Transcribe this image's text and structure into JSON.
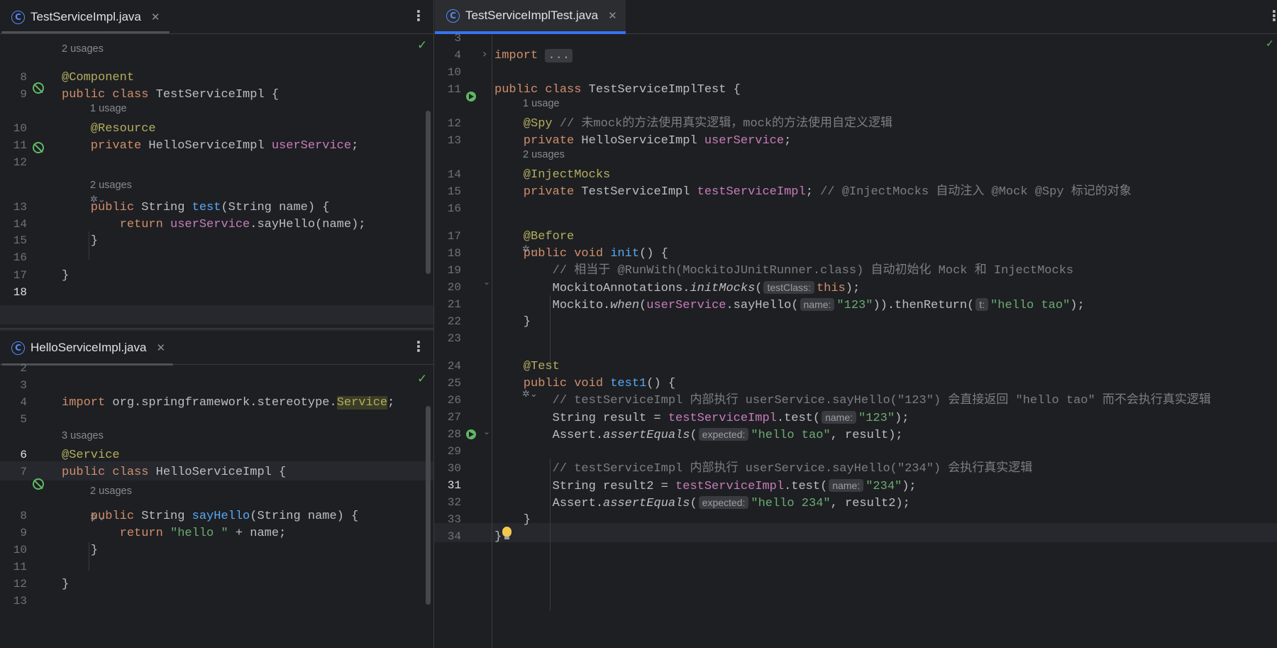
{
  "left_top": {
    "tab": {
      "label": "TestServiceImpl.java"
    },
    "lines": [
      {
        "n": "8",
        "segs": [
          {
            "c": "ann",
            "t": "@Component"
          }
        ]
      },
      {
        "n": "9",
        "segs": [
          {
            "c": "kw",
            "t": "public class "
          },
          {
            "c": "cls",
            "t": "TestServiceImpl {"
          }
        ]
      },
      {
        "n": "10",
        "segs": [
          {
            "c": "ann",
            "t": "    @Resource"
          }
        ]
      },
      {
        "n": "11",
        "segs": [
          {
            "c": "kw",
            "t": "    private "
          },
          {
            "c": "cls",
            "t": "HelloServiceImpl "
          },
          {
            "c": "fld",
            "t": "userService"
          },
          {
            "c": "cls",
            "t": ";"
          }
        ]
      },
      {
        "n": "12",
        "segs": []
      },
      {
        "n": "13",
        "segs": [
          {
            "c": "kw",
            "t": "    public "
          },
          {
            "c": "cls",
            "t": "String "
          },
          {
            "c": "fn",
            "t": "test"
          },
          {
            "c": "cls",
            "t": "(String name) {"
          }
        ]
      },
      {
        "n": "14",
        "segs": [
          {
            "c": "kw",
            "t": "        return "
          },
          {
            "c": "fld",
            "t": "userService"
          },
          {
            "c": "cls",
            "t": ".sayHello(name);"
          }
        ]
      },
      {
        "n": "15",
        "segs": [
          {
            "c": "cls",
            "t": "    }"
          }
        ]
      },
      {
        "n": "16",
        "segs": []
      },
      {
        "n": "17",
        "segs": [
          {
            "c": "cls",
            "t": "}"
          }
        ]
      },
      {
        "n": "18",
        "segs": []
      }
    ],
    "usages": [
      "2 usages",
      "1 usage",
      "2 usages"
    ]
  },
  "left_bottom": {
    "tab": {
      "label": "HelloServiceImpl.java"
    },
    "lines": [
      {
        "n": "2",
        "segs": []
      },
      {
        "n": "3",
        "segs": []
      },
      {
        "n": "4",
        "segs": [
          {
            "c": "kw",
            "t": "import "
          },
          {
            "c": "cls",
            "t": "org.springframework.stereotype."
          },
          {
            "c": "ann svc-box",
            "t": "Service"
          },
          {
            "c": "cls",
            "t": ";"
          }
        ]
      },
      {
        "n": "5",
        "segs": []
      },
      {
        "n": "6",
        "segs": [
          {
            "c": "ann",
            "t": "@Service"
          }
        ]
      },
      {
        "n": "7",
        "segs": [
          {
            "c": "kw",
            "t": "public class "
          },
          {
            "c": "cls",
            "t": "HelloServiceImpl {"
          }
        ]
      },
      {
        "n": "8",
        "segs": [
          {
            "c": "kw",
            "t": "    public "
          },
          {
            "c": "cls",
            "t": "String "
          },
          {
            "c": "fn",
            "t": "sayHello"
          },
          {
            "c": "cls",
            "t": "(String name) {"
          }
        ]
      },
      {
        "n": "9",
        "segs": [
          {
            "c": "kw",
            "t": "        return "
          },
          {
            "c": "str",
            "t": "\"hello \""
          },
          {
            "c": "cls",
            "t": " + name;"
          }
        ]
      },
      {
        "n": "10",
        "segs": [
          {
            "c": "cls",
            "t": "    }"
          }
        ]
      },
      {
        "n": "11",
        "segs": []
      },
      {
        "n": "12",
        "segs": [
          {
            "c": "cls",
            "t": "}"
          }
        ]
      },
      {
        "n": "13",
        "segs": []
      }
    ],
    "usages": [
      "3 usages",
      "2 usages"
    ]
  },
  "right": {
    "tab": {
      "label": "TestServiceImplTest.java"
    },
    "lines": [
      {
        "n": "3",
        "segs": []
      },
      {
        "n": "4",
        "segs": [
          {
            "c": "kw",
            "t": "import "
          },
          {
            "c": "fold-box",
            "t": "..."
          }
        ]
      },
      {
        "n": "10",
        "segs": []
      },
      {
        "n": "11",
        "segs": [
          {
            "c": "kw",
            "t": "public class "
          },
          {
            "c": "cls",
            "t": "TestServiceImplTest {"
          }
        ]
      },
      {
        "n": "12",
        "segs": [
          {
            "c": "ann",
            "t": "    @Spy"
          },
          {
            "c": "cm",
            "t": " // 未mock的方法使用真实逻辑，mock的方法使用自定义逻辑"
          }
        ]
      },
      {
        "n": "13",
        "segs": [
          {
            "c": "kw",
            "t": "    private "
          },
          {
            "c": "cls",
            "t": "HelloServiceImpl "
          },
          {
            "c": "fld",
            "t": "userService"
          },
          {
            "c": "cls",
            "t": ";"
          }
        ]
      },
      {
        "n": "14",
        "segs": [
          {
            "c": "ann",
            "t": "    @InjectMocks"
          }
        ]
      },
      {
        "n": "15",
        "segs": [
          {
            "c": "kw",
            "t": "    private "
          },
          {
            "c": "cls",
            "t": "TestServiceImpl "
          },
          {
            "c": "fld",
            "t": "testServiceImpl"
          },
          {
            "c": "cls",
            "t": "; "
          },
          {
            "c": "cm",
            "t": "// @InjectMocks 自动注入 @Mock @Spy 标记的对象"
          }
        ]
      },
      {
        "n": "16",
        "segs": []
      },
      {
        "n": "17",
        "segs": [
          {
            "c": "ann",
            "t": "    @Before"
          }
        ]
      },
      {
        "n": "18",
        "segs": [
          {
            "c": "kw",
            "t": "    public void "
          },
          {
            "c": "fn",
            "t": "init"
          },
          {
            "c": "cls",
            "t": "() {"
          }
        ]
      },
      {
        "n": "19",
        "segs": [
          {
            "c": "cm",
            "t": "        // 相当于 @RunWith(MockitoJUnitRunner.class) 自动初始化 Mock 和 InjectMocks"
          }
        ]
      },
      {
        "n": "20",
        "segs": [
          {
            "c": "cls",
            "t": "        MockitoAnnotations."
          },
          {
            "c": "cls it",
            "t": "initMocks"
          },
          {
            "c": "cls",
            "t": "("
          },
          {
            "c": "hint",
            "t": "testClass:"
          },
          {
            "c": "kw",
            "t": "this"
          },
          {
            "c": "cls",
            "t": ");"
          }
        ]
      },
      {
        "n": "21",
        "segs": [
          {
            "c": "cls",
            "t": "        Mockito."
          },
          {
            "c": "cls it",
            "t": "when"
          },
          {
            "c": "cls",
            "t": "("
          },
          {
            "c": "fld",
            "t": "userService"
          },
          {
            "c": "cls",
            "t": ".sayHello("
          },
          {
            "c": "hint",
            "t": "name:"
          },
          {
            "c": "str",
            "t": "\"123\""
          },
          {
            "c": "cls",
            "t": ")).thenReturn("
          },
          {
            "c": "hint",
            "t": "t:"
          },
          {
            "c": "str",
            "t": "\"hello tao\""
          },
          {
            "c": "cls",
            "t": ");"
          }
        ]
      },
      {
        "n": "22",
        "segs": [
          {
            "c": "cls",
            "t": "    }"
          }
        ]
      },
      {
        "n": "23",
        "segs": []
      },
      {
        "n": "24",
        "segs": [
          {
            "c": "ann",
            "t": "    @Test"
          }
        ]
      },
      {
        "n": "25",
        "segs": [
          {
            "c": "kw",
            "t": "    public void "
          },
          {
            "c": "fn",
            "t": "test1"
          },
          {
            "c": "cls",
            "t": "() {"
          }
        ]
      },
      {
        "n": "26",
        "segs": [
          {
            "c": "cm",
            "t": "        // testServiceImpl 内部执行 userService.sayHello(\"123\") 会直接返回 \"hello tao\" 而不会执行真实逻辑"
          }
        ]
      },
      {
        "n": "27",
        "segs": [
          {
            "c": "cls",
            "t": "        String result = "
          },
          {
            "c": "fld",
            "t": "testServiceImpl"
          },
          {
            "c": "cls",
            "t": ".test("
          },
          {
            "c": "hint",
            "t": "name:"
          },
          {
            "c": "str",
            "t": "\"123\""
          },
          {
            "c": "cls",
            "t": ");"
          }
        ]
      },
      {
        "n": "28",
        "segs": [
          {
            "c": "cls",
            "t": "        Assert."
          },
          {
            "c": "cls it",
            "t": "assertEquals"
          },
          {
            "c": "cls",
            "t": "("
          },
          {
            "c": "hint",
            "t": "expected:"
          },
          {
            "c": "str",
            "t": "\"hello tao\""
          },
          {
            "c": "cls",
            "t": ", result);"
          }
        ]
      },
      {
        "n": "29",
        "segs": []
      },
      {
        "n": "30",
        "segs": [
          {
            "c": "cm",
            "t": "        // testServiceImpl 内部执行 userService.sayHello(\"234\") 会执行真实逻辑"
          }
        ]
      },
      {
        "n": "31",
        "segs": [
          {
            "c": "cls",
            "t": "        String result2 = "
          },
          {
            "c": "fld",
            "t": "testServiceImpl"
          },
          {
            "c": "cls",
            "t": ".test("
          },
          {
            "c": "hint",
            "t": "name:"
          },
          {
            "c": "str",
            "t": "\"234\""
          },
          {
            "c": "cls",
            "t": ");"
          }
        ]
      },
      {
        "n": "32",
        "segs": [
          {
            "c": "cls",
            "t": "        Assert."
          },
          {
            "c": "cls it",
            "t": "assertEquals"
          },
          {
            "c": "cls",
            "t": "("
          },
          {
            "c": "hint",
            "t": "expected:"
          },
          {
            "c": "str",
            "t": "\"hello 234\""
          },
          {
            "c": "cls",
            "t": ", result2);"
          }
        ]
      },
      {
        "n": "33",
        "segs": [
          {
            "c": "cls",
            "t": "    }"
          }
        ]
      },
      {
        "n": "34",
        "segs": [
          {
            "c": "cls",
            "t": "}"
          }
        ]
      }
    ],
    "usages": [
      "1 usage",
      "2 usages"
    ]
  },
  "icons": {
    "class": "java-class-icon",
    "close": "close-icon",
    "more": "kebab-menu-icon",
    "ok": "inspection-ok-icon",
    "run": "run-test-icon",
    "spring": "spring-bean-icon",
    "bulb": "intention-bulb-icon",
    "ai": "ai-assistant-icon"
  },
  "glyphs": {
    "class": "C",
    "close": "✕",
    "more": "⋮",
    "check": "✓",
    "fold": "›",
    "foldOpen": "⌄"
  },
  "colors": {
    "bg": "#1e1f22",
    "keyword": "#cf8e6d",
    "annotation": "#b3ae60",
    "string": "#6aab73",
    "field": "#c77dbb",
    "method": "#56a8f5",
    "comment": "#7a7e85",
    "accent": "#3574f0"
  }
}
